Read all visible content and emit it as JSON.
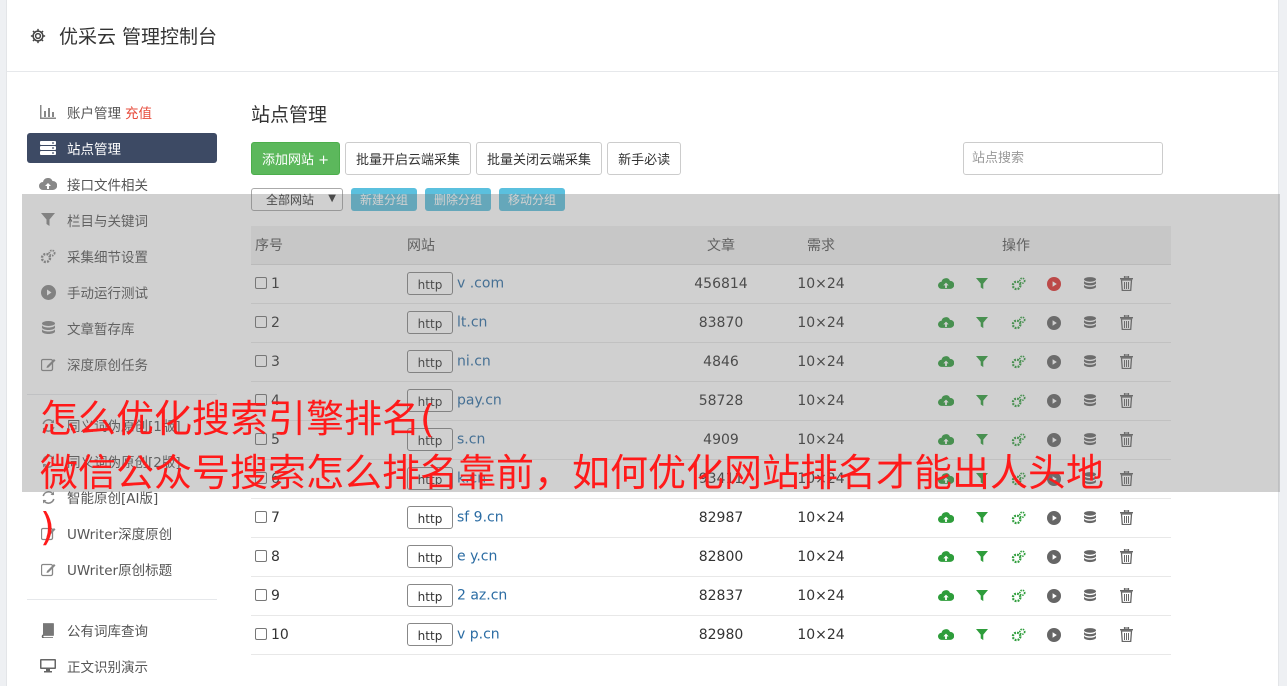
{
  "header": {
    "title": "优采云 管理控制台"
  },
  "sidebar": {
    "items": [
      {
        "label": "账户管理",
        "extra": "充值",
        "icon": "bar-chart-icon"
      },
      {
        "label": "站点管理",
        "icon": "server-icon",
        "active": true
      },
      {
        "label": "接口文件相关",
        "icon": "cloud-upload-icon"
      },
      {
        "label": "栏目与关键词",
        "icon": "filter-icon"
      },
      {
        "label": "采集细节设置",
        "icon": "gears-icon"
      },
      {
        "label": "手动运行测试",
        "icon": "play-circle-icon"
      },
      {
        "label": "文章暂存库",
        "icon": "database-icon"
      },
      {
        "label": "深度原创任务",
        "icon": "edit-icon"
      },
      {
        "label": "同义词伪原创[1版]",
        "icon": "refresh-icon"
      },
      {
        "label": "同义词伪原创[2版]",
        "icon": "refresh-icon"
      },
      {
        "label": "智能原创[AI版]",
        "icon": "refresh-icon"
      },
      {
        "label": "UWriter深度原创",
        "icon": "edit-icon"
      },
      {
        "label": "UWriter原创标题",
        "icon": "edit-icon"
      },
      {
        "label": "公有词库查询",
        "icon": "book-icon"
      },
      {
        "label": "正文识别演示",
        "icon": "monitor-icon"
      }
    ]
  },
  "main": {
    "title": "站点管理",
    "buttons": {
      "add": "添加网站 +",
      "batch_open": "批量开启云端采集",
      "batch_close": "批量关闭云端采集",
      "guide": "新手必读"
    },
    "search_placeholder": "站点搜索",
    "group_select": "全部网站",
    "group_buttons": {
      "new": "新建分组",
      "delete": "删除分组",
      "move": "移动分组"
    },
    "table": {
      "headers": {
        "no": "序号",
        "site": "网站",
        "articles": "文章",
        "demand": "需求",
        "ops": "操作"
      },
      "rows": [
        {
          "no": "1",
          "proto": "http",
          "domain": "v .com",
          "articles": "456814",
          "demand": "10×24",
          "play_active": true
        },
        {
          "no": "2",
          "proto": "http",
          "domain": "lt.cn",
          "articles": "83870",
          "demand": "10×24"
        },
        {
          "no": "3",
          "proto": "http",
          "domain": "ni.cn",
          "articles": "4846",
          "demand": "10×24"
        },
        {
          "no": "4",
          "proto": "http",
          "domain": "pay.cn",
          "articles": "58728",
          "demand": "10×24"
        },
        {
          "no": "5",
          "proto": "http",
          "domain": "s.cn",
          "articles": "4909",
          "demand": "10×24"
        },
        {
          "no": "6",
          "proto": "http",
          "domain": "k.cn",
          "articles": "93411",
          "demand": "10×24"
        },
        {
          "no": "7",
          "proto": "http",
          "domain": "sf 9.cn",
          "articles": "82987",
          "demand": "10×24"
        },
        {
          "no": "8",
          "proto": "http",
          "domain": "e y.cn",
          "articles": "82800",
          "demand": "10×24"
        },
        {
          "no": "9",
          "proto": "http",
          "domain": "2 az.cn",
          "articles": "82837",
          "demand": "10×24"
        },
        {
          "no": "10",
          "proto": "http",
          "domain": "v p.cn",
          "articles": "82980",
          "demand": "10×24"
        }
      ]
    }
  },
  "overlay_text": {
    "line1": "怎么优化搜索引擎排名(",
    "line2": "微信公众号搜索怎么排名靠前，如何优化网站排名才能出人头地",
    "line3": ")"
  },
  "colors": {
    "sidebar_active": "#3d4a64",
    "green": "#5cb85c",
    "info": "#5bc0de",
    "link": "#2b6ca3",
    "headline": "#ff1a1a"
  }
}
